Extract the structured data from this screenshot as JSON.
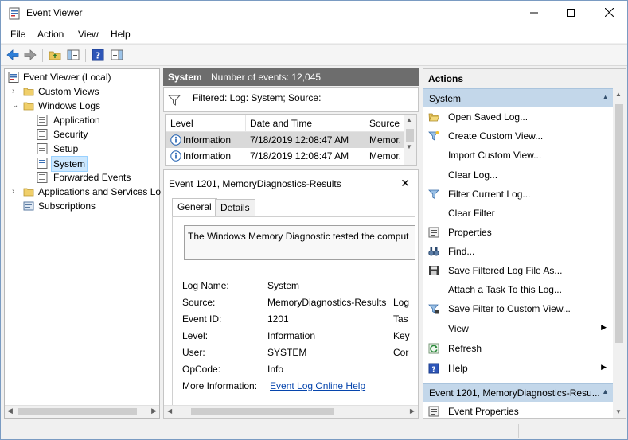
{
  "window": {
    "title": "Event Viewer"
  },
  "menu": [
    "File",
    "Action",
    "View",
    "Help"
  ],
  "tree": {
    "root": "Event Viewer (Local)",
    "custom_views": "Custom Views",
    "windows_logs": "Windows Logs",
    "logs": [
      "Application",
      "Security",
      "Setup",
      "System",
      "Forwarded Events"
    ],
    "applications_services": "Applications and Services Lo",
    "subscriptions": "Subscriptions",
    "selected": "System"
  },
  "center": {
    "log_name": "System",
    "event_count": "Number of events: 12,045",
    "filter_text": "Filtered: Log: System; Source:",
    "columns": [
      "Level",
      "Date and Time",
      "Source"
    ],
    "rows": [
      {
        "level": "Information",
        "datetime": "7/18/2019 12:08:47 AM",
        "source": "Memor."
      },
      {
        "level": "Information",
        "datetime": "7/18/2019 12:08:47 AM",
        "source": "Memor."
      }
    ]
  },
  "detail": {
    "title": "Event 1201, MemoryDiagnostics-Results",
    "tabs": [
      "General",
      "Details"
    ],
    "active_tab": "General",
    "description": "The Windows Memory Diagnostic tested the comput",
    "properties": [
      {
        "label": "Log Name:",
        "value": "System",
        "extra": ""
      },
      {
        "label": "Source:",
        "value": "MemoryDiagnostics-Results",
        "extra": "Log"
      },
      {
        "label": "Event ID:",
        "value": "1201",
        "extra": "Tas"
      },
      {
        "label": "Level:",
        "value": "Information",
        "extra": "Key"
      },
      {
        "label": "User:",
        "value": "SYSTEM",
        "extra": "Cor"
      },
      {
        "label": "OpCode:",
        "value": "Info",
        "extra": ""
      }
    ],
    "more_info_label": "More Information:",
    "more_info_link": "Event Log Online Help"
  },
  "actions": {
    "title": "Actions",
    "section1": "System",
    "items1": [
      {
        "label": "Open Saved Log...",
        "icon": "folder-open-icon"
      },
      {
        "label": "Create Custom View...",
        "icon": "funnel-star-icon"
      },
      {
        "label": "Import Custom View...",
        "icon": ""
      },
      {
        "label": "Clear Log...",
        "icon": ""
      },
      {
        "label": "Filter Current Log...",
        "icon": "funnel-icon"
      },
      {
        "label": "Clear Filter",
        "icon": ""
      },
      {
        "label": "Properties",
        "icon": "properties-icon"
      },
      {
        "label": "Find...",
        "icon": "binoculars-icon"
      },
      {
        "label": "Save Filtered Log File As...",
        "icon": "save-icon"
      },
      {
        "label": "Attach a Task To this Log...",
        "icon": ""
      },
      {
        "label": "Save Filter to Custom View...",
        "icon": "funnel-save-icon"
      },
      {
        "label": "View",
        "icon": "",
        "submenu": true
      },
      {
        "label": "Refresh",
        "icon": "refresh-icon"
      },
      {
        "label": "Help",
        "icon": "help-icon",
        "submenu": true
      }
    ],
    "section2": "Event 1201, MemoryDiagnostics-Resu...",
    "items2": [
      {
        "label": "Event Properties",
        "icon": "properties-icon"
      }
    ]
  },
  "colors": {
    "header_dark": "#6d6d6d",
    "section_blue": "#c3d7ea",
    "selection": "#cce8ff",
    "link": "#0645ad"
  }
}
